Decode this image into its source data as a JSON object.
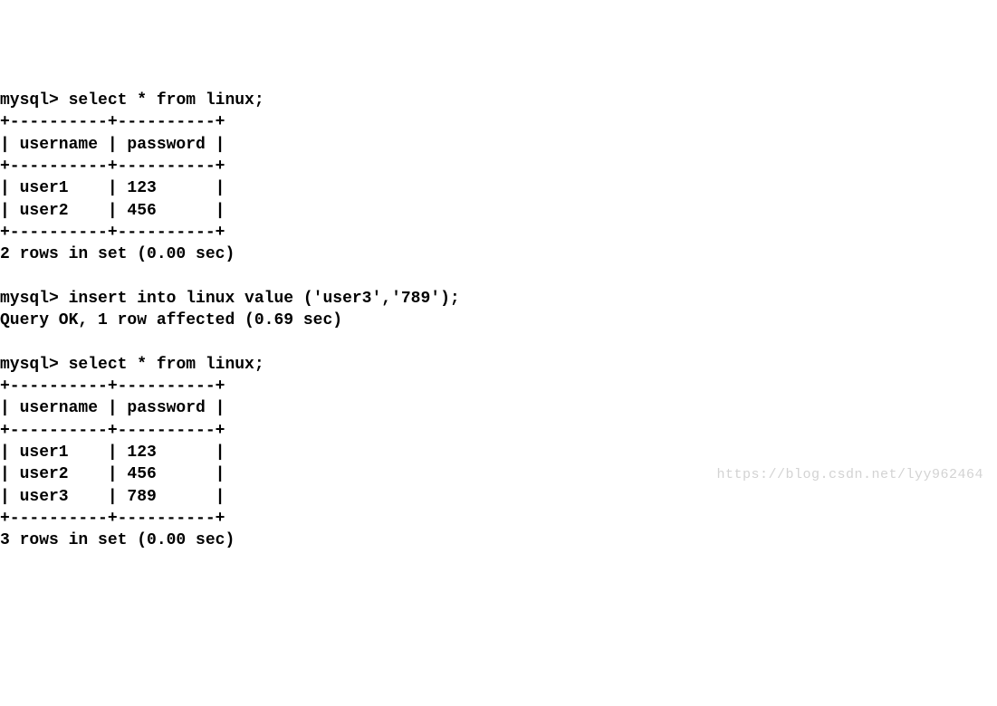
{
  "terminal": {
    "prompt": "mysql>",
    "query1": {
      "command": "select * from linux;",
      "border_top": "+----------+----------+",
      "header": "| username | password |",
      "border_mid": "+----------+----------+",
      "rows": [
        "| user1    | 123      |",
        "| user2    | 456      |"
      ],
      "border_bottom": "+----------+----------+",
      "result": "2 rows in set (0.00 sec)"
    },
    "query2": {
      "command": "insert into linux value ('user3','789');",
      "result": "Query OK, 1 row affected (0.69 sec)"
    },
    "query3": {
      "command": "select * from linux;",
      "border_top": "+----------+----------+",
      "header": "| username | password |",
      "border_mid": "+----------+----------+",
      "rows": [
        "| user1    | 123      |",
        "| user2    | 456      |",
        "| user3    | 789      |"
      ],
      "border_bottom": "+----------+----------+",
      "result": "3 rows in set (0.00 sec)"
    },
    "blank": ""
  },
  "chart_data": {
    "type": "table",
    "title": "linux",
    "columns": [
      "username",
      "password"
    ],
    "table_before_insert": [
      {
        "username": "user1",
        "password": "123"
      },
      {
        "username": "user2",
        "password": "456"
      }
    ],
    "insert_row": {
      "username": "user3",
      "password": "789"
    },
    "table_after_insert": [
      {
        "username": "user1",
        "password": "123"
      },
      {
        "username": "user2",
        "password": "456"
      },
      {
        "username": "user3",
        "password": "789"
      }
    ]
  },
  "watermark": "https://blog.csdn.net/lyy962464"
}
